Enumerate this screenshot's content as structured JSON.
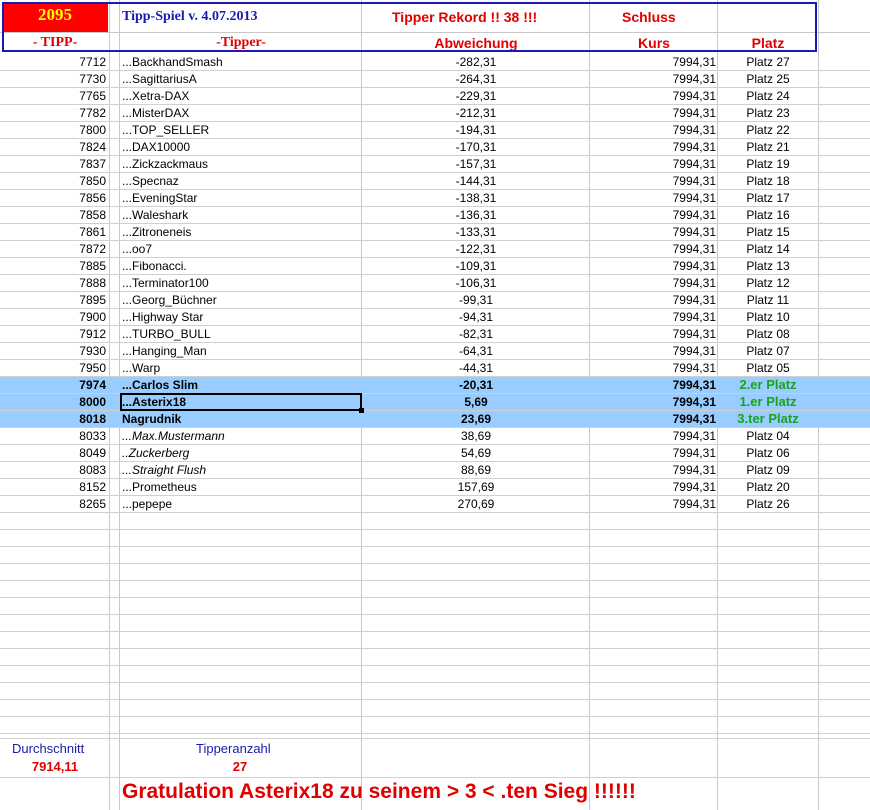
{
  "header": {
    "tipp_count": "2095",
    "title": "Tipp-Spiel v. 4.07.2013",
    "rekord": "Tipper Rekord !!  38  !!!",
    "schluss": "Schluss",
    "col_tipp": "- TIPP-",
    "col_tipper": "-Tipper-",
    "col_abweichung": "Abweichung",
    "col_kurs": "Kurs",
    "col_platz": "Platz"
  },
  "rows": [
    {
      "tipp": "7712",
      "name": "...BackhandSmash",
      "abw": "-282,31",
      "kurs": "7994,31",
      "platz": "Platz 27"
    },
    {
      "tipp": "7730",
      "name": "...SagittariusA",
      "abw": "-264,31",
      "kurs": "7994,31",
      "platz": "Platz 25"
    },
    {
      "tipp": "7765",
      "name": "...Xetra-DAX",
      "abw": "-229,31",
      "kurs": "7994,31",
      "platz": "Platz 24"
    },
    {
      "tipp": "7782",
      "name": "...MisterDAX",
      "abw": "-212,31",
      "kurs": "7994,31",
      "platz": "Platz 23"
    },
    {
      "tipp": "7800",
      "name": "...TOP_SELLER",
      "abw": "-194,31",
      "kurs": "7994,31",
      "platz": "Platz 22"
    },
    {
      "tipp": "7824",
      "name": "...DAX10000",
      "abw": "-170,31",
      "kurs": "7994,31",
      "platz": "Platz 21"
    },
    {
      "tipp": "7837",
      "name": "...Zickzackmaus",
      "abw": "-157,31",
      "kurs": "7994,31",
      "platz": "Platz 19"
    },
    {
      "tipp": "7850",
      "name": "...Specnaz",
      "abw": "-144,31",
      "kurs": "7994,31",
      "platz": "Platz 18"
    },
    {
      "tipp": "7856",
      "name": "...EveningStar",
      "abw": "-138,31",
      "kurs": "7994,31",
      "platz": "Platz 17"
    },
    {
      "tipp": "7858",
      "name": "...Waleshark",
      "abw": "-136,31",
      "kurs": "7994,31",
      "platz": "Platz 16"
    },
    {
      "tipp": "7861",
      "name": "...Zitroneneis",
      "abw": "-133,31",
      "kurs": "7994,31",
      "platz": "Platz 15"
    },
    {
      "tipp": "7872",
      "name": "...oo7",
      "abw": "-122,31",
      "kurs": "7994,31",
      "platz": "Platz 14"
    },
    {
      "tipp": "7885",
      "name": "...Fibonacci.",
      "abw": "-109,31",
      "kurs": "7994,31",
      "platz": "Platz 13"
    },
    {
      "tipp": "7888",
      "name": "...Terminator100",
      "abw": "-106,31",
      "kurs": "7994,31",
      "platz": "Platz 12"
    },
    {
      "tipp": "7895",
      "name": "...Georg_Büchner",
      "abw": "-99,31",
      "kurs": "7994,31",
      "platz": "Platz 11"
    },
    {
      "tipp": "7900",
      "name": "...Highway Star",
      "abw": "-94,31",
      "kurs": "7994,31",
      "platz": "Platz 10"
    },
    {
      "tipp": "7912",
      "name": "...TURBO_BULL",
      "abw": "-82,31",
      "kurs": "7994,31",
      "platz": "Platz 08"
    },
    {
      "tipp": "7930",
      "name": "...Hanging_Man",
      "abw": "-64,31",
      "kurs": "7994,31",
      "platz": "Platz 07"
    },
    {
      "tipp": "7950",
      "name": "...Warp",
      "abw": "-44,31",
      "kurs": "7994,31",
      "platz": "Platz 05"
    },
    {
      "tipp": "7974",
      "name": "...Carlos Slim",
      "abw": "-20,31",
      "kurs": "7994,31",
      "platz": "2.er Platz",
      "style": "hl"
    },
    {
      "tipp": "8000",
      "name": "...Asterix18",
      "abw": "5,69",
      "kurs": "7994,31",
      "platz": "1.er Platz",
      "style": "hl"
    },
    {
      "tipp": "8018",
      "name": " Nagrudnik",
      "abw": "23,69",
      "kurs": "7994,31",
      "platz": "3.ter Platz",
      "style": "hl"
    },
    {
      "tipp": "8033",
      "name": "...Max.Mustermann",
      "abw": "38,69",
      "kurs": "7994,31",
      "platz": "Platz 04",
      "style": "it"
    },
    {
      "tipp": "8049",
      "name": "..Zuckerberg",
      "abw": "54,69",
      "kurs": "7994,31",
      "platz": "Platz 06",
      "style": "it"
    },
    {
      "tipp": "8083",
      "name": "...Straight Flush",
      "abw": "88,69",
      "kurs": "7994,31",
      "platz": "Platz 09",
      "style": "it"
    },
    {
      "tipp": "8152",
      "name": "...Prometheus",
      "abw": "157,69",
      "kurs": "7994,31",
      "platz": "Platz 20"
    },
    {
      "tipp": "8265",
      "name": "...pepepe",
      "abw": "270,69",
      "kurs": "7994,31",
      "platz": "Platz 26"
    }
  ],
  "footer": {
    "durchschnitt_label": "Durchschnitt",
    "durchschnitt": "7914,11",
    "tipperanzahl_label": "Tipperanzahl",
    "tipperanzahl": "27",
    "gratulation": "Gratulation Asterix18 zu seinem > 3 < .ten Sieg !!!!!!"
  }
}
